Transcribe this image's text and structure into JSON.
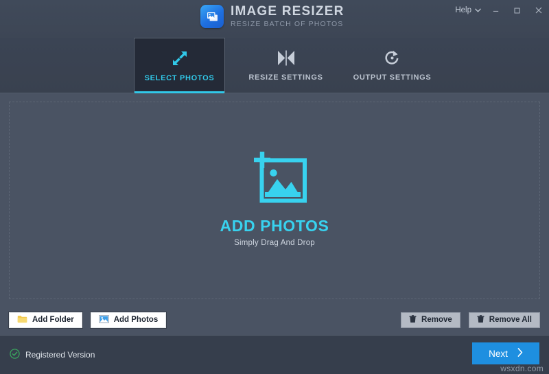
{
  "window": {
    "help_label": "Help",
    "help_chevron_icon": "chevron-down-icon",
    "minimize_icon": "minimize-icon",
    "maximize_icon": "maximize-icon",
    "close_icon": "close-icon"
  },
  "brand": {
    "logo_icon": "image-resizer-logo-icon",
    "title": "IMAGE RESIZER",
    "subtitle": "RESIZE BATCH OF PHOTOS"
  },
  "tabs": [
    {
      "id": "select-photos",
      "label": "SELECT PHOTOS",
      "icon": "resize-arrows-icon",
      "active": true
    },
    {
      "id": "resize-settings",
      "label": "RESIZE SETTINGS",
      "icon": "collapse-arrows-icon",
      "active": false
    },
    {
      "id": "output-settings",
      "label": "OUTPUT SETTINGS",
      "icon": "refresh-circle-icon",
      "active": false
    }
  ],
  "dropzone": {
    "icon": "add-photo-frame-icon",
    "title": "ADD PHOTOS",
    "subtitle": "Simply Drag And Drop"
  },
  "actions": {
    "add_folder": {
      "label": "Add Folder",
      "icon": "folder-icon"
    },
    "add_photos": {
      "label": "Add Photos",
      "icon": "photo-icon"
    },
    "remove": {
      "label": "Remove",
      "icon": "trash-icon"
    },
    "remove_all": {
      "label": "Remove All",
      "icon": "trash-icon"
    }
  },
  "footer": {
    "registered_label": "Registered Version",
    "registered_icon": "check-circle-icon",
    "next_label": "Next",
    "next_icon": "chevron-right-icon",
    "watermark": "wsxdn.com"
  },
  "colors": {
    "accent_cyan": "#31c8e8",
    "accent_blue": "#1e8fe0",
    "background": "#4a5363",
    "header": "#3d4655",
    "footer": "#363e4c",
    "status_green": "#3aa85f"
  }
}
